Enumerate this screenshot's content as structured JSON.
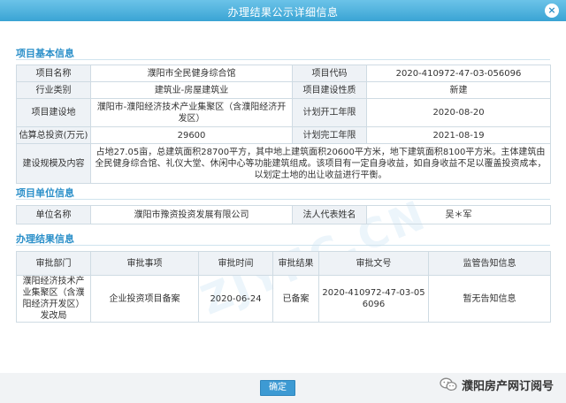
{
  "window": {
    "title": "办理结果公示详细信息",
    "close_glyph": "×"
  },
  "basic_info": {
    "section_title": "项目基本信息",
    "rows": [
      {
        "label1": "项目名称",
        "value1": "濮阳市全民健身综合馆",
        "label2": "项目代码",
        "value2": "2020-410972-47-03-056096"
      },
      {
        "label1": "行业类别",
        "value1": "建筑业-房屋建筑业",
        "label2": "项目建设性质",
        "value2": "新建"
      },
      {
        "label1": "项目建设地",
        "value1": "濮阳市-濮阳经济技术产业集聚区（含濮阳经济开发区）",
        "label2": "计划开工年限",
        "value2": "2020-08-20"
      },
      {
        "label1": "估算总投资(万元)",
        "value1": "29600",
        "label2": "计划完工年限",
        "value2": "2021-08-19"
      }
    ],
    "scale_label": "建设规模及内容",
    "scale_value": "占地27.05亩，总建筑面积28700平方，其中地上建筑面积20600平方米，地下建筑面积8100平方米。主体建筑由全民健身综合馆、礼仪大堂、休闲中心等功能建筑组成。该项目有一定自身收益，如自身收益不足以覆盖投资成本，以划定土地的出让收益进行平衡。"
  },
  "unit_info": {
    "section_title": "项目单位信息",
    "label1": "单位名称",
    "value1": "濮阳市豫资投资发展有限公司",
    "label2": "法人代表姓名",
    "value2": "吴＊军"
  },
  "result_info": {
    "section_title": "办理结果信息",
    "headers": [
      "审批部门",
      "审批事项",
      "审批时间",
      "审批结果",
      "审批文号",
      "监管告知信息"
    ],
    "rows": [
      {
        "dept": "濮阳经济技术产业集聚区（含濮阳经济开发区）发改局",
        "item": "企业投资项目备案",
        "time": "2020-06-24",
        "result": "已备案",
        "doc_no": "2020-410972-47-03-056096",
        "notice": "暂无告知信息"
      }
    ]
  },
  "watermark": "ZJYFC.CN",
  "footer": {
    "ok_label": "确定",
    "brand_text": "濮阳房产网订阅号",
    "brand_icon": "wechat-icon"
  }
}
